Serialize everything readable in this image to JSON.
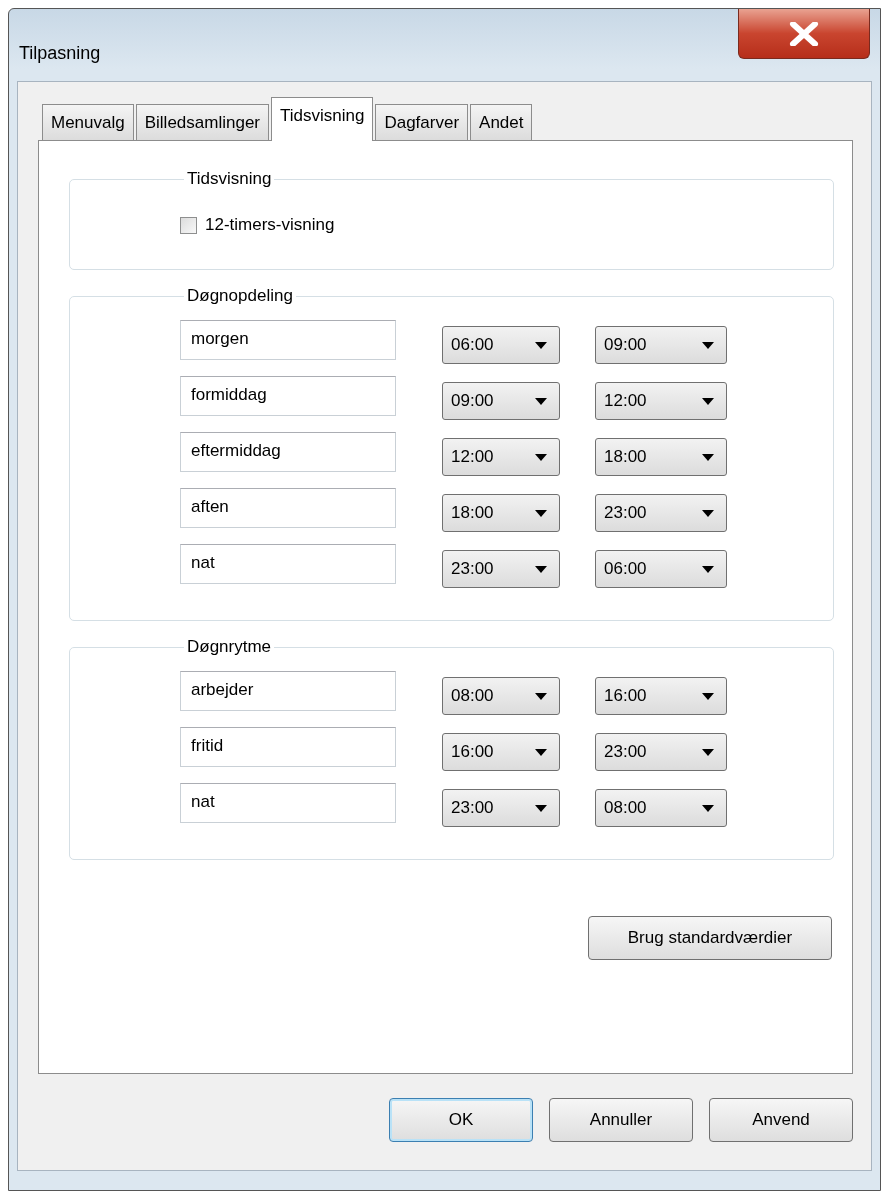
{
  "window": {
    "title": "Tilpasning"
  },
  "tabs": [
    {
      "label": "Menuvalg",
      "selected": false
    },
    {
      "label": "Billedsamlinger",
      "selected": false
    },
    {
      "label": "Tidsvisning",
      "selected": true
    },
    {
      "label": "Dagfarver",
      "selected": false
    },
    {
      "label": "Andet",
      "selected": false
    }
  ],
  "groups": [
    {
      "title": "Tidsvisning",
      "kind": "checkboxes",
      "items": [
        {
          "label": "12-timers-visning",
          "checked": false
        }
      ]
    },
    {
      "title": "Døgnopdeling",
      "kind": "periods",
      "rows": [
        {
          "name": "morgen",
          "from": "06:00",
          "to": "09:00"
        },
        {
          "name": "formiddag",
          "from": "09:00",
          "to": "12:00"
        },
        {
          "name": "eftermiddag",
          "from": "12:00",
          "to": "18:00"
        },
        {
          "name": "aften",
          "from": "18:00",
          "to": "23:00"
        },
        {
          "name": "nat",
          "from": "23:00",
          "to": "06:00"
        }
      ]
    },
    {
      "title": "Døgnrytme",
      "kind": "periods",
      "rows": [
        {
          "name": "arbejder",
          "from": "08:00",
          "to": "16:00"
        },
        {
          "name": "fritid",
          "from": "16:00",
          "to": "23:00"
        },
        {
          "name": "nat",
          "from": "23:00",
          "to": "08:00"
        }
      ]
    }
  ],
  "defaults_button": "Brug standardværdier",
  "buttons": [
    {
      "label": "OK",
      "default": true
    },
    {
      "label": "Annuller",
      "default": false
    },
    {
      "label": "Anvend",
      "default": false
    }
  ]
}
